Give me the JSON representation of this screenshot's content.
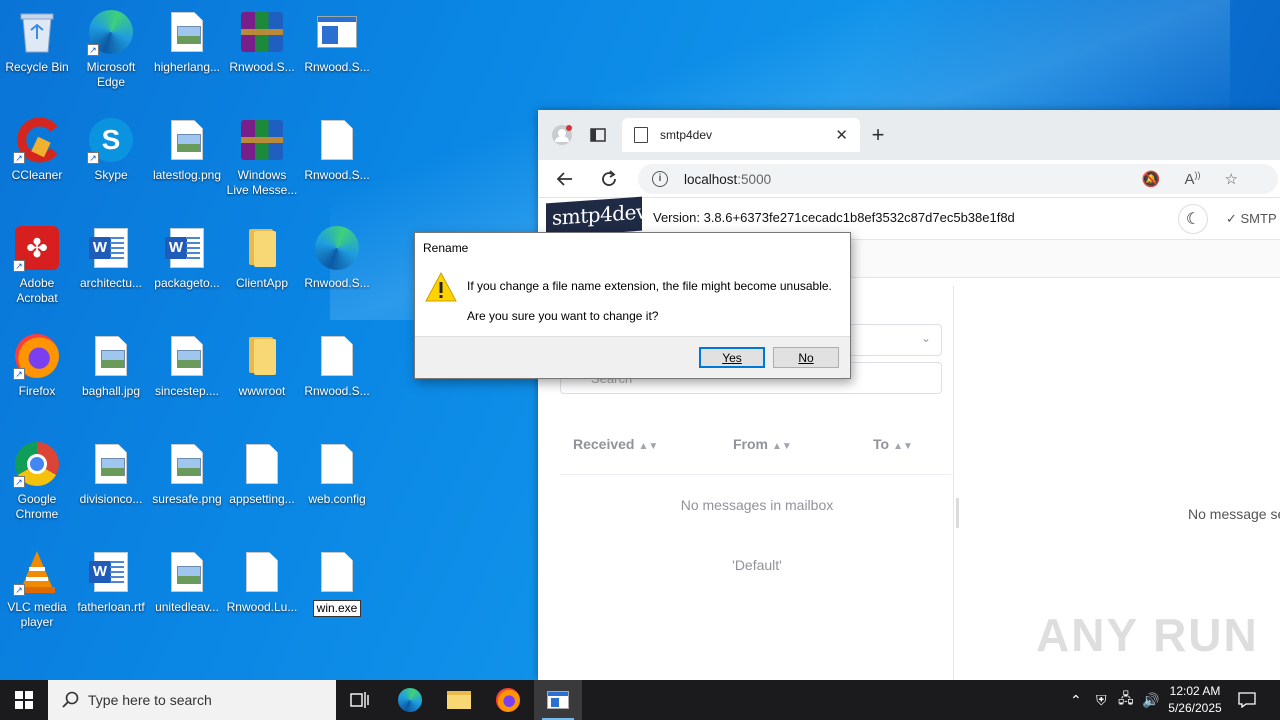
{
  "desktop": {
    "icons": [
      {
        "label": "Recycle Bin"
      },
      {
        "label": "Microsoft Edge"
      },
      {
        "label": "higherlang..."
      },
      {
        "label": "Rnwood.S..."
      },
      {
        "label": "Rnwood.S..."
      },
      {
        "label": "CCleaner"
      },
      {
        "label": "Skype"
      },
      {
        "label": "latestlog.png"
      },
      {
        "label": "Windows Live Messe..."
      },
      {
        "label": "Rnwood.S..."
      },
      {
        "label": "Adobe Acrobat"
      },
      {
        "label": "architectu..."
      },
      {
        "label": "packageto..."
      },
      {
        "label": "ClientApp"
      },
      {
        "label": "Rnwood.S..."
      },
      {
        "label": "Firefox"
      },
      {
        "label": "baghall.jpg"
      },
      {
        "label": "sincestep...."
      },
      {
        "label": "wwwroot"
      },
      {
        "label": "Rnwood.S..."
      },
      {
        "label": "Google Chrome"
      },
      {
        "label": "divisionco..."
      },
      {
        "label": "suresafe.png"
      },
      {
        "label": "appsetting..."
      },
      {
        "label": "web.config"
      },
      {
        "label": "VLC media player"
      },
      {
        "label": "fatherloan.rtf"
      },
      {
        "label": "unitedleav..."
      },
      {
        "label": "Rnwood.Lu..."
      },
      {
        "label": "win.exe"
      }
    ]
  },
  "browser": {
    "tab_title": "smtp4dev",
    "tab_close": "✕",
    "new_tab": "+",
    "url_host": "localhost",
    "url_port": ":5000",
    "app": {
      "logo_text": "smtp4dev",
      "version": "Version: 3.8.6+6373fe271cecadc1b8ef3532c87d7ec5b38e1f8d",
      "smtp_status": "SMTP",
      "search_placeholder": "Search",
      "columns": [
        {
          "label": "Received"
        },
        {
          "label": "From"
        },
        {
          "label": "To"
        }
      ],
      "empty_text": "No messages in mailbox",
      "mailbox_name": "'Default'",
      "right_empty": "No message se"
    }
  },
  "dialog": {
    "title": "Rename",
    "message1": "If you change a file name extension, the file might become unusable.",
    "message2": "Are you sure you want to change it?",
    "yes": "Yes",
    "no": "No"
  },
  "taskbar": {
    "search_placeholder": "Type here to search",
    "time": "12:02 AM",
    "date": "5/26/2025"
  },
  "watermark": "ANY RUN",
  "colors": {
    "accent": "#0078d7",
    "taskbar": "#1b1b1d"
  }
}
